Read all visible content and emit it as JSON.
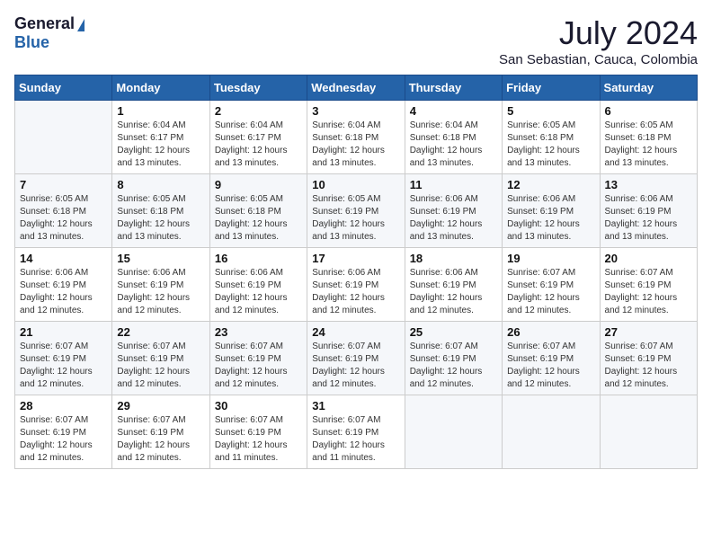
{
  "logo": {
    "general": "General",
    "blue": "Blue"
  },
  "title": {
    "month_year": "July 2024",
    "location": "San Sebastian, Cauca, Colombia"
  },
  "days_of_week": [
    "Sunday",
    "Monday",
    "Tuesday",
    "Wednesday",
    "Thursday",
    "Friday",
    "Saturday"
  ],
  "weeks": [
    [
      {
        "day": "",
        "info": ""
      },
      {
        "day": "1",
        "info": "Sunrise: 6:04 AM\nSunset: 6:17 PM\nDaylight: 12 hours\nand 13 minutes."
      },
      {
        "day": "2",
        "info": "Sunrise: 6:04 AM\nSunset: 6:17 PM\nDaylight: 12 hours\nand 13 minutes."
      },
      {
        "day": "3",
        "info": "Sunrise: 6:04 AM\nSunset: 6:18 PM\nDaylight: 12 hours\nand 13 minutes."
      },
      {
        "day": "4",
        "info": "Sunrise: 6:04 AM\nSunset: 6:18 PM\nDaylight: 12 hours\nand 13 minutes."
      },
      {
        "day": "5",
        "info": "Sunrise: 6:05 AM\nSunset: 6:18 PM\nDaylight: 12 hours\nand 13 minutes."
      },
      {
        "day": "6",
        "info": "Sunrise: 6:05 AM\nSunset: 6:18 PM\nDaylight: 12 hours\nand 13 minutes."
      }
    ],
    [
      {
        "day": "7",
        "info": "Sunrise: 6:05 AM\nSunset: 6:18 PM\nDaylight: 12 hours\nand 13 minutes."
      },
      {
        "day": "8",
        "info": "Sunrise: 6:05 AM\nSunset: 6:18 PM\nDaylight: 12 hours\nand 13 minutes."
      },
      {
        "day": "9",
        "info": "Sunrise: 6:05 AM\nSunset: 6:18 PM\nDaylight: 12 hours\nand 13 minutes."
      },
      {
        "day": "10",
        "info": "Sunrise: 6:05 AM\nSunset: 6:19 PM\nDaylight: 12 hours\nand 13 minutes."
      },
      {
        "day": "11",
        "info": "Sunrise: 6:06 AM\nSunset: 6:19 PM\nDaylight: 12 hours\nand 13 minutes."
      },
      {
        "day": "12",
        "info": "Sunrise: 6:06 AM\nSunset: 6:19 PM\nDaylight: 12 hours\nand 13 minutes."
      },
      {
        "day": "13",
        "info": "Sunrise: 6:06 AM\nSunset: 6:19 PM\nDaylight: 12 hours\nand 13 minutes."
      }
    ],
    [
      {
        "day": "14",
        "info": "Sunrise: 6:06 AM\nSunset: 6:19 PM\nDaylight: 12 hours\nand 12 minutes."
      },
      {
        "day": "15",
        "info": "Sunrise: 6:06 AM\nSunset: 6:19 PM\nDaylight: 12 hours\nand 12 minutes."
      },
      {
        "day": "16",
        "info": "Sunrise: 6:06 AM\nSunset: 6:19 PM\nDaylight: 12 hours\nand 12 minutes."
      },
      {
        "day": "17",
        "info": "Sunrise: 6:06 AM\nSunset: 6:19 PM\nDaylight: 12 hours\nand 12 minutes."
      },
      {
        "day": "18",
        "info": "Sunrise: 6:06 AM\nSunset: 6:19 PM\nDaylight: 12 hours\nand 12 minutes."
      },
      {
        "day": "19",
        "info": "Sunrise: 6:07 AM\nSunset: 6:19 PM\nDaylight: 12 hours\nand 12 minutes."
      },
      {
        "day": "20",
        "info": "Sunrise: 6:07 AM\nSunset: 6:19 PM\nDaylight: 12 hours\nand 12 minutes."
      }
    ],
    [
      {
        "day": "21",
        "info": "Sunrise: 6:07 AM\nSunset: 6:19 PM\nDaylight: 12 hours\nand 12 minutes."
      },
      {
        "day": "22",
        "info": "Sunrise: 6:07 AM\nSunset: 6:19 PM\nDaylight: 12 hours\nand 12 minutes."
      },
      {
        "day": "23",
        "info": "Sunrise: 6:07 AM\nSunset: 6:19 PM\nDaylight: 12 hours\nand 12 minutes."
      },
      {
        "day": "24",
        "info": "Sunrise: 6:07 AM\nSunset: 6:19 PM\nDaylight: 12 hours\nand 12 minutes."
      },
      {
        "day": "25",
        "info": "Sunrise: 6:07 AM\nSunset: 6:19 PM\nDaylight: 12 hours\nand 12 minutes."
      },
      {
        "day": "26",
        "info": "Sunrise: 6:07 AM\nSunset: 6:19 PM\nDaylight: 12 hours\nand 12 minutes."
      },
      {
        "day": "27",
        "info": "Sunrise: 6:07 AM\nSunset: 6:19 PM\nDaylight: 12 hours\nand 12 minutes."
      }
    ],
    [
      {
        "day": "28",
        "info": "Sunrise: 6:07 AM\nSunset: 6:19 PM\nDaylight: 12 hours\nand 12 minutes."
      },
      {
        "day": "29",
        "info": "Sunrise: 6:07 AM\nSunset: 6:19 PM\nDaylight: 12 hours\nand 12 minutes."
      },
      {
        "day": "30",
        "info": "Sunrise: 6:07 AM\nSunset: 6:19 PM\nDaylight: 12 hours\nand 11 minutes."
      },
      {
        "day": "31",
        "info": "Sunrise: 6:07 AM\nSunset: 6:19 PM\nDaylight: 12 hours\nand 11 minutes."
      },
      {
        "day": "",
        "info": ""
      },
      {
        "day": "",
        "info": ""
      },
      {
        "day": "",
        "info": ""
      }
    ]
  ]
}
